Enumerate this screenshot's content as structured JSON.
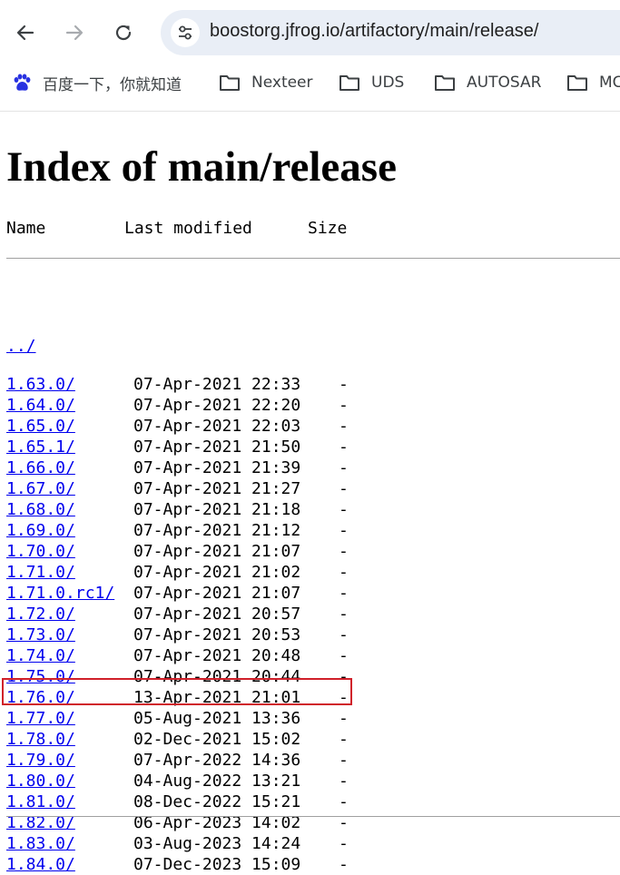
{
  "browser": {
    "url": "boostorg.jfrog.io/artifactory/main/release/",
    "bookmarks": [
      {
        "label": "百度一下，你就知道",
        "icon": "baidu-paw-icon"
      },
      {
        "label": "Nexteer",
        "icon": "folder-icon"
      },
      {
        "label": "UDS",
        "icon": "folder-icon"
      },
      {
        "label": "AUTOSAR",
        "icon": "folder-icon"
      },
      {
        "label": "MC",
        "icon": "folder-icon"
      }
    ]
  },
  "page": {
    "title": "Index of main/release",
    "columns": {
      "name": "Name",
      "modified": "Last modified",
      "size": "Size"
    },
    "parent_link": "../",
    "entries": [
      {
        "name": "1.63.0/",
        "modified": "07-Apr-2021 22:33",
        "size": "-"
      },
      {
        "name": "1.64.0/",
        "modified": "07-Apr-2021 22:20",
        "size": "-"
      },
      {
        "name": "1.65.0/",
        "modified": "07-Apr-2021 22:03",
        "size": "-"
      },
      {
        "name": "1.65.1/",
        "modified": "07-Apr-2021 21:50",
        "size": "-"
      },
      {
        "name": "1.66.0/",
        "modified": "07-Apr-2021 21:39",
        "size": "-"
      },
      {
        "name": "1.67.0/",
        "modified": "07-Apr-2021 21:27",
        "size": "-"
      },
      {
        "name": "1.68.0/",
        "modified": "07-Apr-2021 21:18",
        "size": "-"
      },
      {
        "name": "1.69.0/",
        "modified": "07-Apr-2021 21:12",
        "size": "-"
      },
      {
        "name": "1.70.0/",
        "modified": "07-Apr-2021 21:07",
        "size": "-"
      },
      {
        "name": "1.71.0/",
        "modified": "07-Apr-2021 21:02",
        "size": "-"
      },
      {
        "name": "1.71.0.rc1/",
        "modified": "07-Apr-2021 21:07",
        "size": "-"
      },
      {
        "name": "1.72.0/",
        "modified": "07-Apr-2021 20:57",
        "size": "-"
      },
      {
        "name": "1.73.0/",
        "modified": "07-Apr-2021 20:53",
        "size": "-"
      },
      {
        "name": "1.74.0/",
        "modified": "07-Apr-2021 20:48",
        "size": "-"
      },
      {
        "name": "1.75.0/",
        "modified": "07-Apr-2021 20:44",
        "size": "-"
      },
      {
        "name": "1.76.0/",
        "modified": "13-Apr-2021 21:01",
        "size": "-",
        "highlighted": true
      },
      {
        "name": "1.77.0/",
        "modified": "05-Aug-2021 13:36",
        "size": "-"
      },
      {
        "name": "1.78.0/",
        "modified": "02-Dec-2021 15:02",
        "size": "-"
      },
      {
        "name": "1.79.0/",
        "modified": "07-Apr-2022 14:36",
        "size": "-"
      },
      {
        "name": "1.80.0/",
        "modified": "04-Aug-2022 13:21",
        "size": "-"
      },
      {
        "name": "1.81.0/",
        "modified": "08-Dec-2022 15:21",
        "size": "-"
      },
      {
        "name": "1.82.0/",
        "modified": "06-Apr-2023 14:02",
        "size": "-"
      },
      {
        "name": "1.83.0/",
        "modified": "03-Aug-2023 14:24",
        "size": "-"
      },
      {
        "name": "1.84.0/",
        "modified": "07-Dec-2023 15:09",
        "size": "-"
      }
    ]
  },
  "colors": {
    "link": "#0000ee",
    "highlight_box": "#d0202a",
    "omnibox_bg": "#e9eef6"
  }
}
